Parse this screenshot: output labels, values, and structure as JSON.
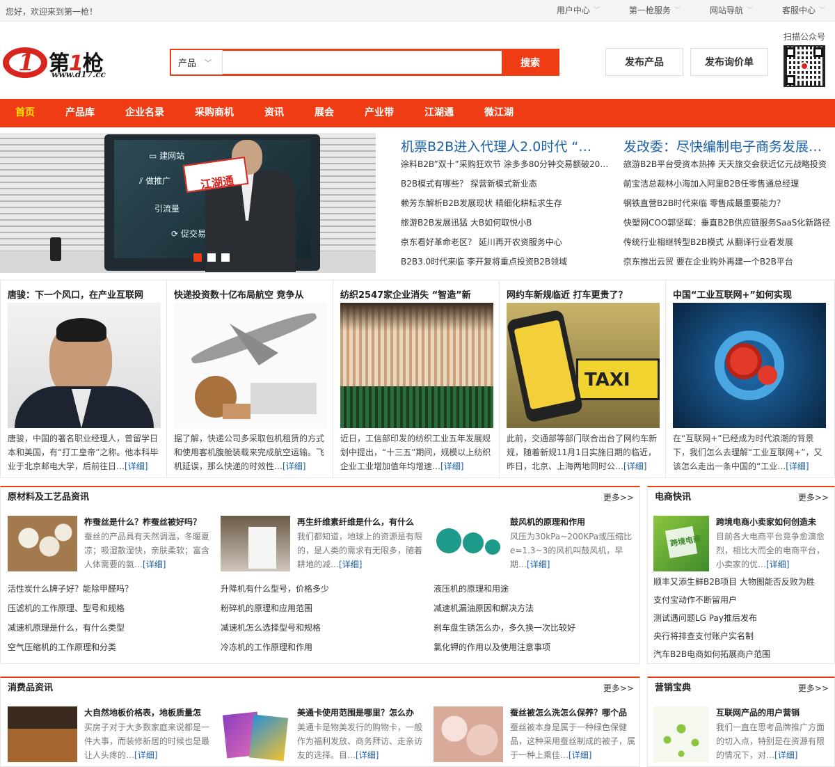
{
  "topbar": {
    "welcome": "您好，欢迎来到第一枪！",
    "links": [
      "用户中心",
      "第一枪服务",
      "网站导航",
      "客服中心"
    ]
  },
  "logo": {
    "brand_a": "第",
    "brand_b": "1",
    "brand_c": "枪",
    "url": "www.d17.cc"
  },
  "search": {
    "category": "产品",
    "placeholder": "",
    "button": "搜索"
  },
  "header_buttons": {
    "post_product": "发布产品",
    "post_inquiry": "发布询价单"
  },
  "qr": {
    "label": "扫描公众号"
  },
  "nav": {
    "items": [
      "首页",
      "产品库",
      "企业名录",
      "采购商机",
      "资讯",
      "展会",
      "产业带",
      "江湖通",
      "微江湖"
    ],
    "active": 0
  },
  "banner": {
    "menu": [
      "建网站",
      "做推广",
      "引流量",
      "促交易"
    ],
    "card_text": "江湖通",
    "slide_count": 3,
    "active_slide": 0
  },
  "headlines": {
    "col1": {
      "title": "机票B2B进入代理人2.0时代 “…",
      "items": [
        "涂料B2B”双十”采购狂欢节 涂多多80分钟交易额破20…",
        "B2B模式有哪些？ 探营新模式新业态",
        "赖芳东解析B2B发展现状 精细化耕耘求生存",
        "旅游B2B发展迅猛 大B如何取悦小B",
        "京东看好革命老区？ 延川再开农资服务中心",
        "B2B3.0时代来临 李开复将重点投资B2B领域"
      ]
    },
    "col2": {
      "title": "发改委：尽快编制电子商务发展…",
      "items": [
        "旅游B2B平台受资本热捧 天天旅交会获近亿元战略投资",
        "前宝洁总裁林小海加入阿里B2B任零售通总经理",
        "钢铁直营B2B时代来临 零售成最重要能力？",
        "快塑网COO郭坚晖：垂直B2B供应链服务SaaS化新路径",
        "传统行业相继转型B2B模式 从翻译行业看发展",
        "京东推出云贸 要在企业购外再建一个B2B平台"
      ]
    }
  },
  "cards": [
    {
      "title": "唐骏：下一个风口，在产业互联网",
      "desc": "唐骏，中国的著名职业经理人，曾留学日本和美国，有“打工皇帝”之称。他本科毕业于北京邮电大学，后前往日…",
      "more": "[详细]"
    },
    {
      "title": "快递投资数十亿布局航空 竞争从",
      "desc": "据了解，快递公司多采取包机租赁的方式和使用客机腹舱装载来完成航空运输。飞机延误，那么快递的时效性…",
      "more": "[详细]"
    },
    {
      "title": "纺织2547家企业消失 “智造”新",
      "desc": "近日，工信部印发的纺织工业五年发展规划中提出，“十三五”期间，规模以上纺织企业工业增加值年均增速…",
      "more": "[详细]"
    },
    {
      "title": "网约车新规临近 打车更贵了？",
      "desc": "此前，交通部等部门联合出台了网约车新规，随着新规11月1日实施日期的临近，昨日，北京、上海两地同时公…",
      "more": "[详细]"
    },
    {
      "title": "中国“工业互联网+”如何实现",
      "desc": "在“互联网+”已经成为时代浪潮的背景下，我们怎么去理解“工业互联网+”，又该怎么走出一条中国的“工业…",
      "more": "[详细]"
    }
  ],
  "panel_materials": {
    "title": "原材料及工艺品资讯",
    "more": "更多>>",
    "features": [
      {
        "title": "柞蚕丝是什么？柞蚕丝被好吗？",
        "desc": "蚕丝的产品具有天然调温，冬暖夏凉；吸湿散湿快，亲肤柔软；富含人体需要的氨…",
        "more": "[详细]"
      },
      {
        "title": "再生纤维素纤维是什么，有什么",
        "desc": "我们都知道，地球上的资源是有限的，是人类的需求有无限多，随着耕地的减…",
        "more": "[详细]"
      },
      {
        "title": "鼓风机的原理和作用",
        "desc": "风压为30kPa~200KPa或压缩比e=1.3~3的风机叫鼓风机，早期…",
        "more": "[详细]"
      }
    ],
    "lists": [
      [
        "活性炭什么牌子好？能除甲醛吗？",
        "压滤机的工作原理、型号和规格",
        "减速机原理是什么，有什么类型",
        "空气压缩机的工作原理和分类"
      ],
      [
        "升降机有什么型号，价格多少",
        "粉碎机的原理和应用范围",
        "减速机怎么选择型号和规格",
        "冷冻机的工作原理和作用"
      ],
      [
        "液压机的原理和用途",
        "减速机漏油原因和解决方法",
        "刹车盘生锈怎么办，多久换一次比较好",
        "氯化钾的作用以及使用注意事项"
      ]
    ]
  },
  "panel_ecom": {
    "title": "电商快讯",
    "more": "更多>>",
    "feature": {
      "title": "跨境电商小卖家如何创造未",
      "desc": "目前各大电商平台竞争愈演愈烈，相比大而全的电商平台，小卖家的优…",
      "more": "[详细]",
      "img_text": "跨境电商"
    },
    "items": [
      "顺丰又添生鲜B2B项目 大物图能否反败为胜",
      "支付宝动作不断留用户",
      "测试遇问题LG Pay推后发布",
      "央行将排查支付账户实名制",
      "汽车B2B电商如何拓展商户范围"
    ]
  },
  "panel_consumer": {
    "title": "消费品资讯",
    "more": "更多>>",
    "features": [
      {
        "title": "大自然地板价格表，地板质量怎",
        "desc": "买房子对于大多数家庭来说都是一件大事，而装修新居的时候也是最让人头疼的…",
        "more": "[详细]"
      },
      {
        "title": "美通卡使用范围是哪里？怎么办",
        "desc": "美通卡是物美发行的购物卡，一般作为福利发放、商务拜访、走亲访友的选择。目…",
        "more": "[详细]"
      },
      {
        "title": "蚕丝被怎么洗怎么保养？哪个品",
        "desc": "蚕丝被本身是属于一种绿色保健品，这种采用蚕丝制成的被子，属于一种上乘佳…",
        "more": "[详细]"
      }
    ]
  },
  "panel_marketing": {
    "title": "营销宝典",
    "more": "更多>>",
    "feature": {
      "title": "互联网产品的用户营销",
      "desc": "我们一直在思考品牌推广方面的切入点，特别是在资源有限的情况下，对…",
      "more": "[详细]"
    }
  }
}
